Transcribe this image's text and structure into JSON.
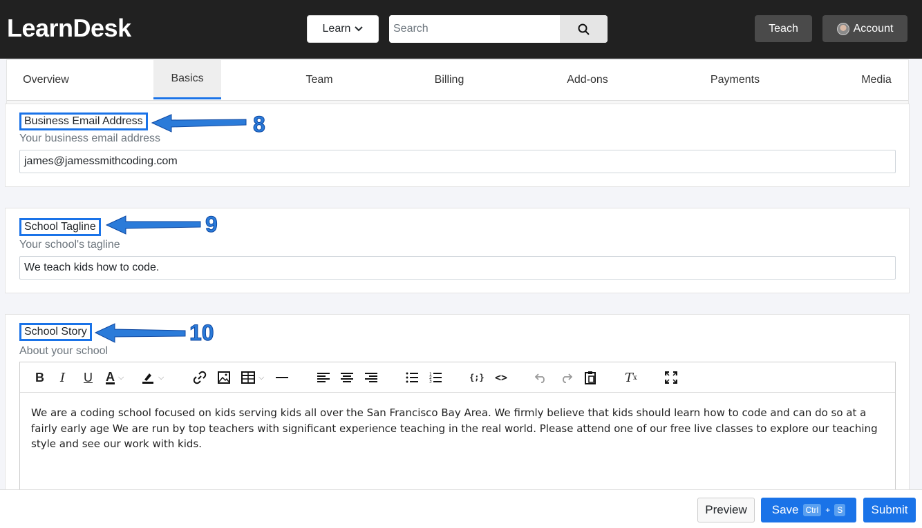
{
  "app": {
    "brand": "LearnDesk"
  },
  "nav": {
    "learn_label": "Learn",
    "search_placeholder": "Search",
    "teach_label": "Teach",
    "account_label": "Account"
  },
  "tabs": [
    {
      "label": "Overview",
      "active": false
    },
    {
      "label": "Basics",
      "active": true
    },
    {
      "label": "Team",
      "active": false
    },
    {
      "label": "Billing",
      "active": false
    },
    {
      "label": "Add-ons",
      "active": false
    },
    {
      "label": "Payments",
      "active": false
    },
    {
      "label": "Media",
      "active": false
    }
  ],
  "fields": {
    "email": {
      "label": "Business Email Address",
      "help": "Your business email address",
      "value": "james@jamessmithcoding.com",
      "annotation": "8"
    },
    "tagline": {
      "label": "School Tagline",
      "help": "Your school's tagline",
      "value": "We teach kids how to code.",
      "annotation": "9"
    },
    "story": {
      "label": "School Story",
      "help": "About your school",
      "value": "We are a coding school focused on kids serving kids all over the San Francisco Bay Area. We firmly believe that kids should learn how to code and can do so at a fairly early age We are run by top teachers with significant experience teaching in the real world. Please attend one of our free live classes to explore our teaching style and see our work with kids.",
      "annotation": "10"
    }
  },
  "editor_toolbar": [
    "bold-icon",
    "italic-icon",
    "underline-icon",
    "text-color-icon",
    "highlight-icon",
    "link-icon",
    "image-icon",
    "table-icon",
    "horizontal-rule-icon",
    "align-left-icon",
    "align-center-icon",
    "align-right-icon",
    "bullet-list-icon",
    "numbered-list-icon",
    "code-block-icon",
    "source-code-icon",
    "undo-icon",
    "redo-icon",
    "paste-icon",
    "clear-format-icon",
    "fullscreen-icon"
  ],
  "footer": {
    "preview_label": "Preview",
    "save_label": "Save",
    "save_kbd_1": "Ctrl",
    "save_kbd_plus": "+",
    "save_kbd_2": "S",
    "submit_label": "Submit"
  },
  "colors": {
    "accent": "#1a73e8",
    "topbar": "#212121",
    "annotation": "#2b7bd9"
  }
}
